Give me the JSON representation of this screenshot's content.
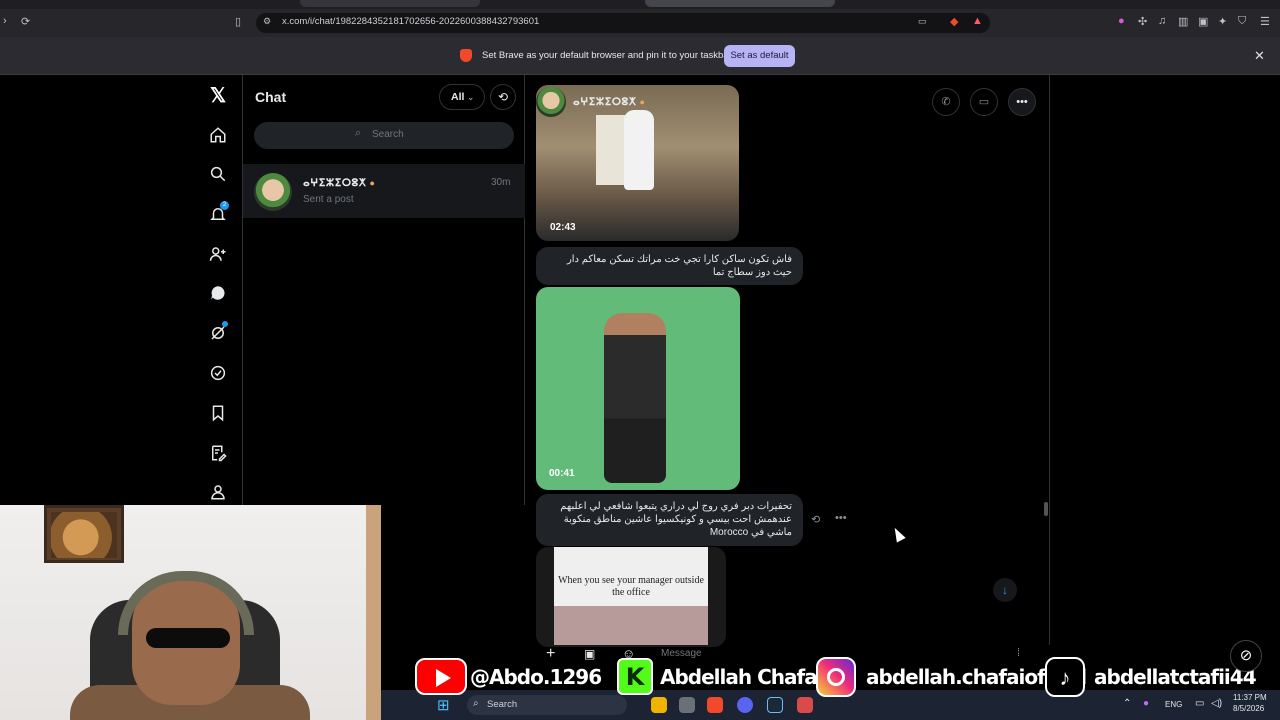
{
  "browser": {
    "url": "x.com/i/chat/1982284352181702656-2022600388432793601",
    "notice_text": "Set Brave as your default browser and pin it to your taskbar",
    "notice_button": "Set as default"
  },
  "nav": {
    "items": [
      "x-logo-icon",
      "home-icon",
      "search-icon",
      "notifications-icon",
      "follow-icon",
      "chat-icon",
      "grok-icon",
      "verified-icon",
      "bookmark-icon",
      "lists-icon",
      "profile-icon"
    ],
    "notifications_badge": "2"
  },
  "chat_list": {
    "title": "Chat",
    "filter_label": "All",
    "search_placeholder": "Search",
    "conversations": [
      {
        "name": "ⴰⵖⵉⵣⵉⵔⵓⵅ",
        "preview": "Sent a post",
        "time": "30m"
      }
    ]
  },
  "thread": {
    "contact_name": "ⴰⵖⵉⵣⵉⵔⵓⵅ",
    "messages": [
      {
        "type": "video",
        "duration": "02:43"
      },
      {
        "type": "text",
        "text": "فاش تكون ساكن كارا تجي خت مراتك تسكن معاكم دار حيث دوز سطاج تما"
      },
      {
        "type": "video",
        "duration": "00:41"
      },
      {
        "type": "text",
        "text": "تحفيرات دبر فري روج لي دراري يتبعوا شافعي لي اعلبهم عندهمش احت بيسي و كونيكسيوا عاشين مناطق منكوبة ماشي في Morocco"
      },
      {
        "type": "image",
        "caption": "When you see your manager outside the office"
      }
    ],
    "composer_placeholder": "Message"
  },
  "overlay": {
    "youtube_handle": "@Abdo.1296",
    "kick_name": "Abdellah Chafai",
    "instagram_handle": "abdellah.chafaioffitid",
    "tiktok_handle": "abdellatctafii44"
  },
  "taskbar": {
    "search_label": "Search",
    "language": "ENG",
    "time": "11:37 PM",
    "date": "8/5/2026"
  },
  "colors": {
    "accent": "#1d9bf0",
    "notice_button_bg": "#b7b4f5",
    "bubble_bg": "#202327",
    "green_screen": "#62bb79"
  }
}
